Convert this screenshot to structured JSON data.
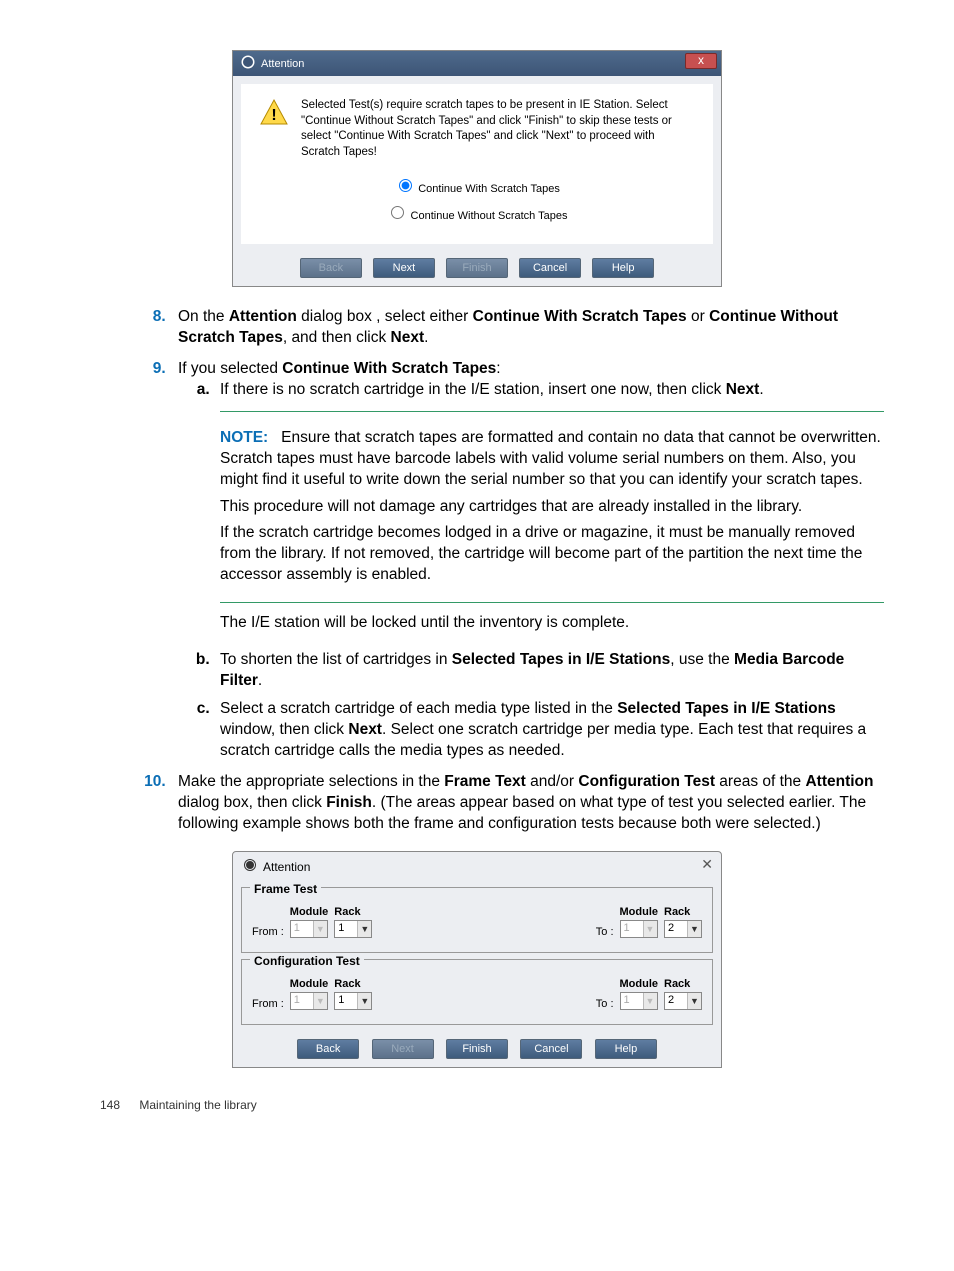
{
  "dialog1": {
    "title": "Attention",
    "message": "Selected Test(s) require scratch tapes to be present in IE Station. Select \"Continue Without Scratch Tapes\" and click \"Finish\" to skip these tests or select \"Continue With Scratch Tapes\" and click \"Next\" to proceed with Scratch Tapes!",
    "radio_with": "Continue With Scratch Tapes",
    "radio_without": "Continue Without Scratch Tapes",
    "buttons": {
      "back": "Back",
      "next": "Next",
      "finish": "Finish",
      "cancel": "Cancel",
      "help": "Help"
    }
  },
  "steps": {
    "s8": {
      "prefix": "On the ",
      "b1": "Attention",
      "mid1": " dialog box , select either ",
      "b2": "Continue With Scratch Tapes",
      "mid2": " or ",
      "b3": "Continue Without Scratch Tapes",
      "mid3": ", and then click ",
      "b4": "Next",
      "end": "."
    },
    "s9": {
      "prefix": "If you selected ",
      "b1": "Continue With Scratch Tapes",
      "end": ":"
    },
    "s9a": {
      "text": "If there is no scratch cartridge in the I/E station, insert one now, then click ",
      "b1": "Next",
      "end": "."
    },
    "note": {
      "label": "NOTE:",
      "p1": "Ensure that scratch tapes are formatted and contain no data that cannot be overwritten. Scratch tapes must have barcode labels with valid volume serial numbers on them. Also, you might find it useful to write down the serial number so that you can identify your scratch tapes.",
      "p2": "This procedure will not damage any cartridges that are already installed in the library.",
      "p3": "If the scratch cartridge becomes lodged in a drive or magazine, it must be manually removed from the library. If not removed, the cartridge will become part of the partition the next time the accessor assembly is enabled.",
      "p4": "The I/E station will be locked until the inventory is complete."
    },
    "s9b": {
      "prefix": "To shorten the list of cartridges in ",
      "b1": "Selected Tapes in I/E Stations",
      "mid": ", use the ",
      "b2": "Media Barcode Filter",
      "end": "."
    },
    "s9c": {
      "prefix": "Select a scratch cartridge of each media type listed in the ",
      "b1": "Selected Tapes in I/E Stations",
      "mid": " window, then click ",
      "b2": "Next",
      "end": ". Select one scratch cartridge per media type. Each test that requires a scratch cartridge calls the media types as needed."
    },
    "s10": {
      "prefix": "Make the appropriate selections in the ",
      "b1": "Frame Text",
      "mid1": " and/or ",
      "b2": "Configuration Test",
      "mid2": " areas of the ",
      "b3": "Attention",
      "mid3": " dialog box, then click ",
      "b4": "Finish",
      "end": ". (The areas appear based on what type of test you selected earlier. The following example shows both the frame and configuration tests because both were selected.)"
    }
  },
  "dialog2": {
    "title": "Attention",
    "frame_legend": "Frame Test",
    "config_legend": "Configuration Test",
    "labels": {
      "module": "Module",
      "rack": "Rack",
      "from": "From :",
      "to": "To :"
    },
    "values": {
      "from_mod": "1",
      "from_rack": "1",
      "to_mod": "1",
      "to_rack": "2"
    },
    "buttons": {
      "back": "Back",
      "next": "Next",
      "finish": "Finish",
      "cancel": "Cancel",
      "help": "Help"
    }
  },
  "footer": {
    "page": "148",
    "section": "Maintaining the library"
  }
}
